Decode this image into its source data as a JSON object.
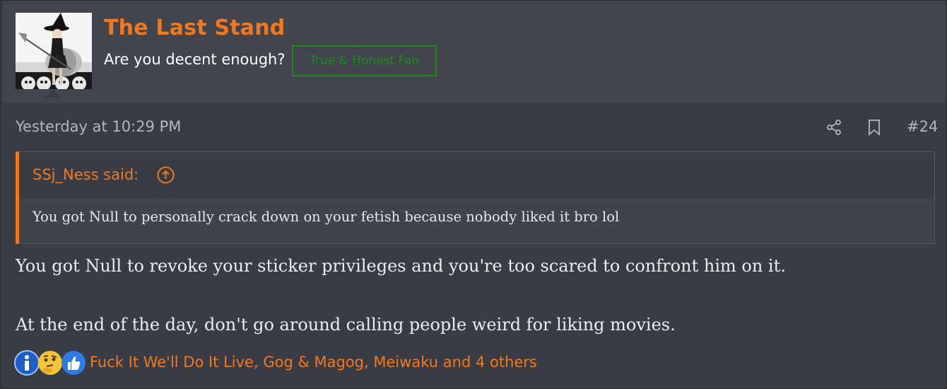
{
  "user": {
    "name": "The Last Stand",
    "title": "Are you decent enough?",
    "banner": "True & Honest Fan"
  },
  "post": {
    "date": "Yesterday at 10:29 PM",
    "number": "#24",
    "share_icon": "share-icon",
    "bookmark_icon": "bookmark-icon"
  },
  "quote": {
    "author": "SSj_Ness said:",
    "jump_icon": "arrow-up-circle-icon",
    "text": "You got Null to personally crack down on your fetish because nobody liked it bro lol"
  },
  "message": {
    "lines": [
      "You got Null to revoke your sticker privileges and you're too scared to confront him on it.",
      "At the end of the day, don't go around calling people weird for liking movies."
    ]
  },
  "reactions": {
    "icons": [
      "informative-icon",
      "thinking-icon",
      "like-icon"
    ],
    "users_text": "Fuck It We'll Do It Live, Gog & Magog, Meiwaku and 4 others"
  },
  "colors": {
    "accent": "#f2781e",
    "banner_green": "#1e8a1e",
    "background": "#393c44",
    "header_bg": "#42454e"
  }
}
